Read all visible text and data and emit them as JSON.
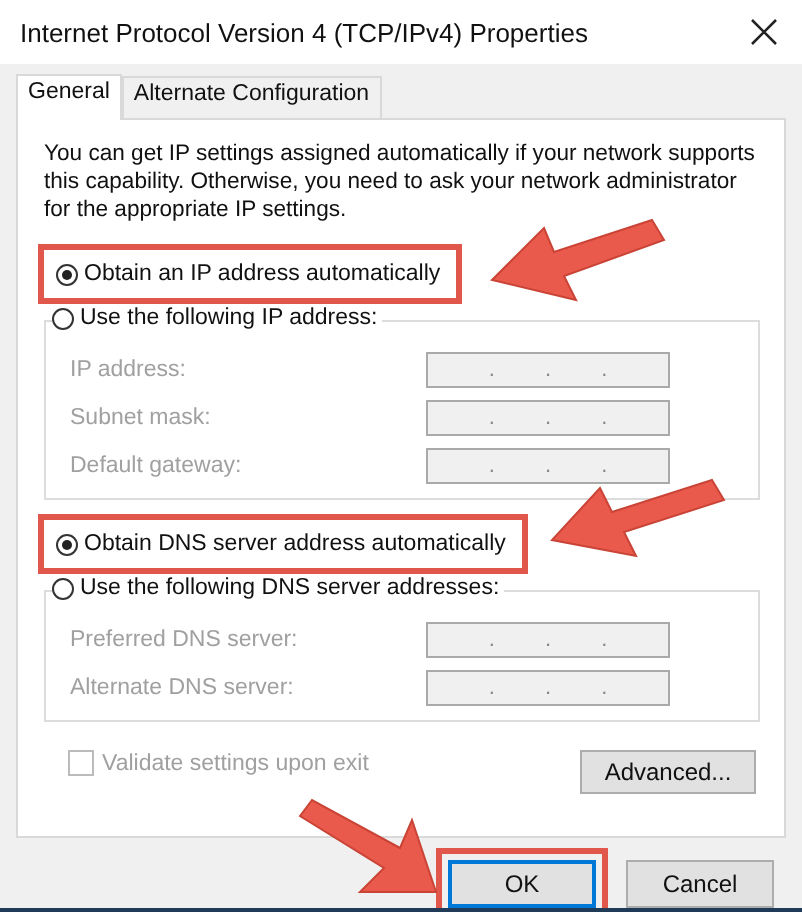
{
  "window": {
    "title": "Internet Protocol Version 4 (TCP/IPv4) Properties"
  },
  "tabs": [
    {
      "label": "General",
      "selected": true
    },
    {
      "label": "Alternate Configuration",
      "selected": false
    }
  ],
  "description": "You can get IP settings assigned automatically if your network supports this capability. Otherwise, you need to ask your network administrator for the appropriate IP settings.",
  "sections": [
    {
      "options": [
        {
          "label": "Obtain an IP address automatically",
          "selected": true,
          "highlighted": true
        },
        {
          "label": "Use the following IP address:",
          "selected": false
        }
      ],
      "fields": [
        {
          "label": "IP address:",
          "value": ". . .",
          "disabled": true
        },
        {
          "label": "Subnet mask:",
          "value": ". . .",
          "disabled": true
        },
        {
          "label": "Default gateway:",
          "value": ". . .",
          "disabled": true
        }
      ]
    },
    {
      "options": [
        {
          "label": "Obtain DNS server address automatically",
          "selected": true,
          "highlighted": true
        },
        {
          "label": "Use the following DNS server addresses:",
          "selected": false
        }
      ],
      "fields": [
        {
          "label": "Preferred DNS server:",
          "value": ". . .",
          "disabled": true
        },
        {
          "label": "Alternate DNS server:",
          "value": ". . .",
          "disabled": true
        }
      ]
    }
  ],
  "validate": {
    "label": "Validate settings upon exit",
    "checked": false,
    "disabled": true
  },
  "advanced_button": "Advanced...",
  "buttons": [
    {
      "label": "OK",
      "default": true,
      "highlighted": true
    },
    {
      "label": "Cancel",
      "default": false
    }
  ]
}
